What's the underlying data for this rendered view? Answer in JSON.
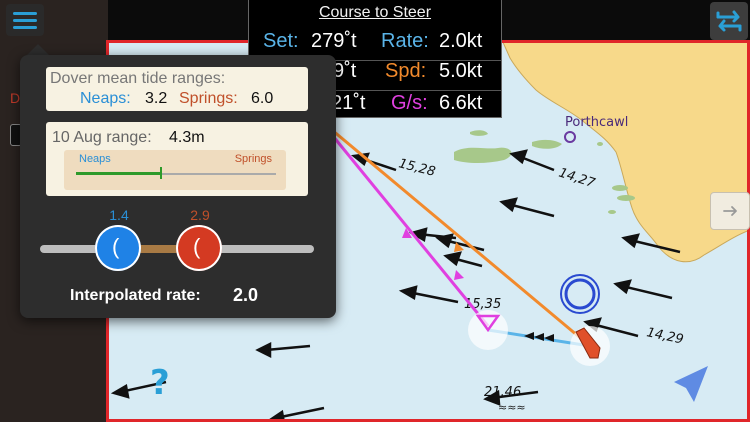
{
  "course_to_steer": {
    "title": "Course to Steer",
    "set_label": "Set:",
    "set_value": "279˚t",
    "rate_label": "Rate:",
    "rate_value": "2.0kt",
    "row2_partial": "9˚t",
    "spd_label": "Spd:",
    "spd_value": "5.0kt",
    "row3_partial": "21˚t",
    "gs_label": "G/s:",
    "gs_value": "6.6kt"
  },
  "tide_panel": {
    "ranges_heading": "Dover mean tide ranges:",
    "neaps_label": "Neaps:",
    "neaps_value": "3.2",
    "springs_label": "Springs:",
    "springs_value": "6.0",
    "date_label": "10 Aug range:",
    "date_value": "4.3m",
    "bar_neaps": "Neaps",
    "bar_springs": "Springs",
    "bar_position": 0.42,
    "slider_low_value": "1.4",
    "slider_high_value": "2.9",
    "interpolated_label": "Interpolated rate:",
    "interpolated_value": "2.0"
  },
  "map": {
    "place_name": "Porthcawl",
    "stream_labels": [
      "15,28",
      "14,27",
      "15,35",
      "14,29",
      "21,46"
    ],
    "help_glyph": "?",
    "left_partial_text": "D"
  },
  "colors": {
    "set_color": "#5ab4e8",
    "rate_color": "#5ab4e8",
    "spd_color": "#f28a2c",
    "gs_color": "#e040e0",
    "neaps_color": "#2a8fd6",
    "springs_color": "#c0502a",
    "chart_border": "#e0262a",
    "sea": "#d7ebf4",
    "land": "#f7d98a"
  }
}
